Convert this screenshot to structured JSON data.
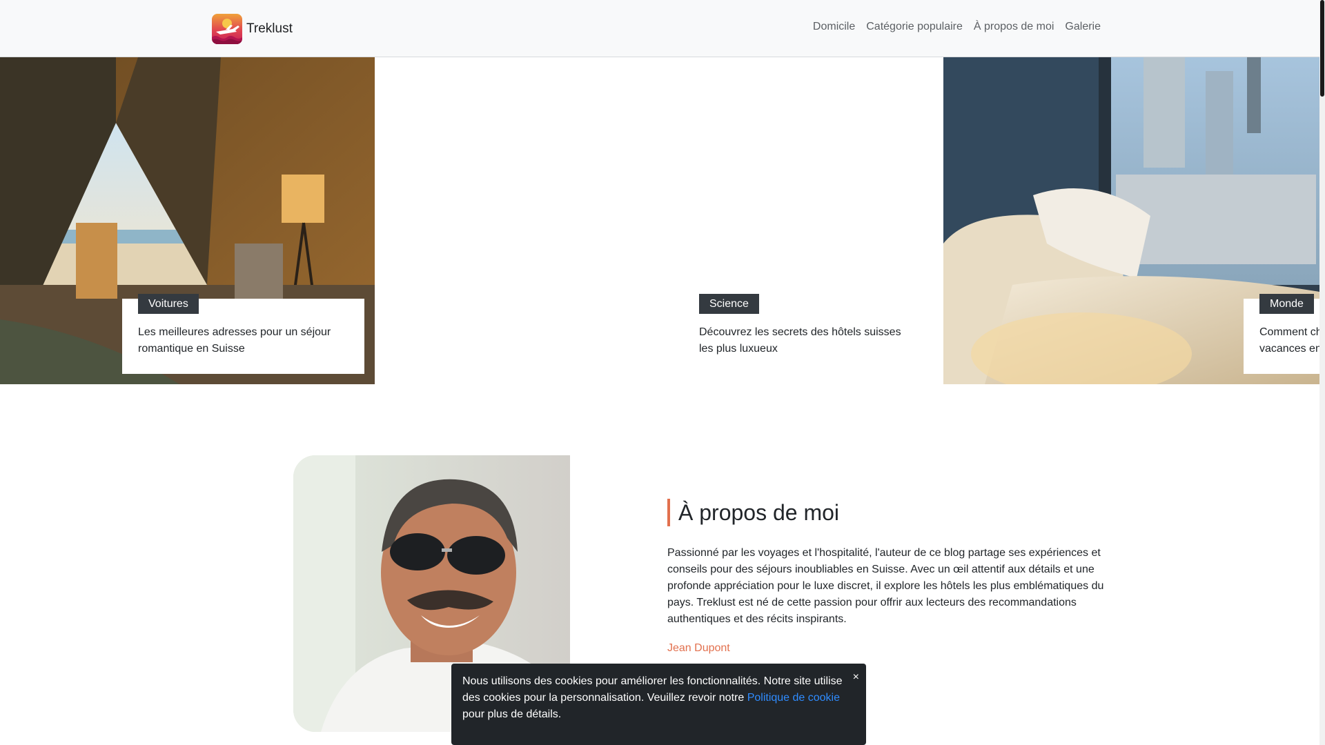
{
  "navbar": {
    "brand_name": "Treklust",
    "links": [
      "Domicile",
      "Catégorie populaire",
      "À propos de moi",
      "Galerie"
    ]
  },
  "featured": [
    {
      "category": "Voitures",
      "title": "Les meilleures adresses pour un séjour romantique en Suisse"
    },
    {
      "category": "Science",
      "title": "Découvrez les secrets des hôtels suisses les plus luxueux"
    },
    {
      "category": "Monde",
      "title": "Comment choisir l'hôtel parfait pour des vacances en famille"
    }
  ],
  "about": {
    "heading": "À propos de moi",
    "text": "Passionné par les voyages et l'hospitalité, l'auteur de ce blog partage ses expériences et conseils pour des séjours inoubliables en Suisse. Avec un œil attentif aux détails et une profonde appréciation pour le luxe discret, il explore les hôtels les plus emblématiques du pays. Treklust est né de cette passion pour offrir aux lecteurs des recommandations authentiques et des récits inspirants.",
    "author": "Jean Dupont"
  },
  "cookie": {
    "text_before": "Nous utilisons des cookies pour améliorer les fonctionnalités. Notre site utilise des cookies pour la personnalisation. Veuillez revoir notre ",
    "link_label": "Politique de cookie",
    "text_after": " pour plus de détails.",
    "close_label": "×"
  },
  "colors": {
    "accent": "#e2704e",
    "badge_bg": "#343a40",
    "navbar_bg": "#f8f9fa",
    "cookie_bg": "#212529",
    "cookie_link": "#2f8cff"
  },
  "icons": {
    "brand": "airplane-sunset-logo-icon",
    "close": "close-icon"
  }
}
